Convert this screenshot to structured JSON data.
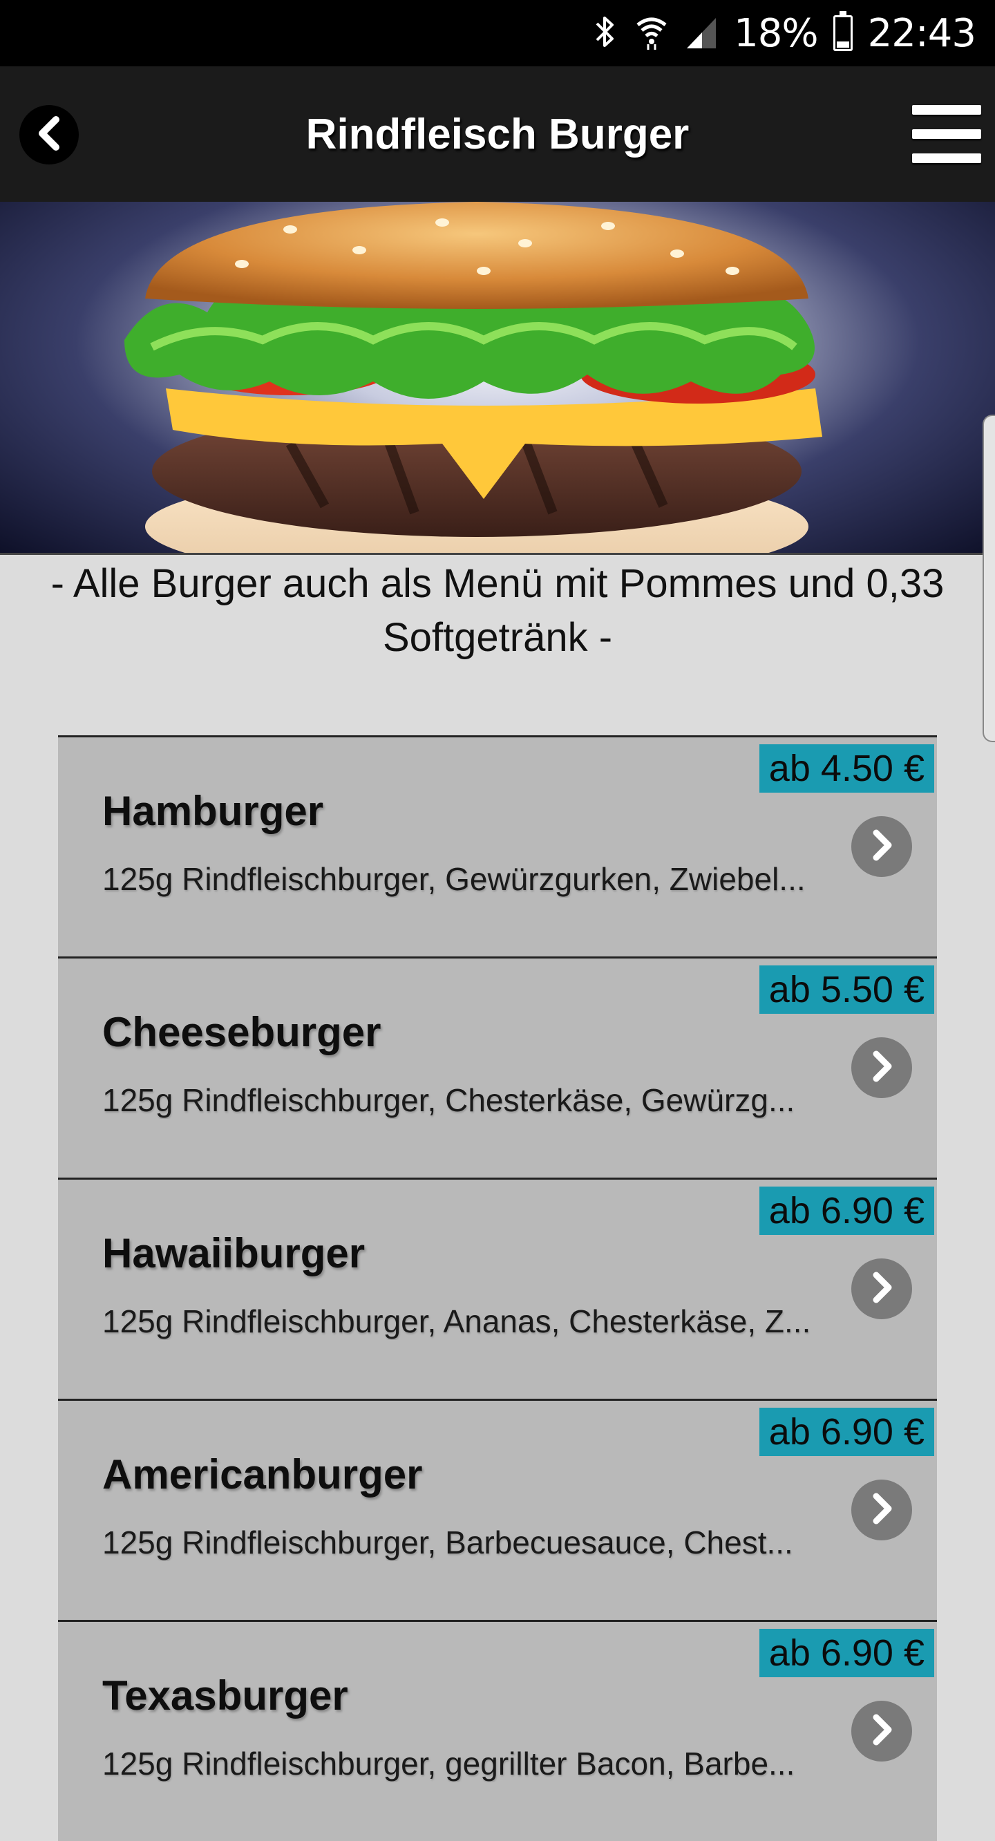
{
  "status_bar": {
    "battery": "18%",
    "time": "22:43",
    "icons": [
      "bluetooth-icon",
      "wifi-icon",
      "signal-icon",
      "battery-icon"
    ]
  },
  "header": {
    "title": "Rindfleisch Burger",
    "back_icon": "chevron-left-icon",
    "menu_icon": "hamburger-menu-icon"
  },
  "notice": {
    "line1": "- Alle Burger auch als Menü mit Pommes und 0,33",
    "line2": "Softgetränk -"
  },
  "colors": {
    "price_badge": "#1a9bb1",
    "item_background": "#b9b9b9",
    "header_background": "#1b1b1b"
  },
  "items": [
    {
      "name": "Hamburger",
      "price": "ab 4.50 €",
      "description": "125g Rindfleischburger, Gewürzgurken, Zwiebel..."
    },
    {
      "name": "Cheeseburger",
      "price": "ab 5.50 €",
      "description": "125g Rindfleischburger, Chesterkäse, Gewürzg..."
    },
    {
      "name": "Hawaiiburger",
      "price": "ab 6.90 €",
      "description": "125g Rindfleischburger, Ananas, Chesterkäse, Z..."
    },
    {
      "name": "Americanburger",
      "price": "ab 6.90 €",
      "description": "125g Rindfleischburger, Barbecuesauce, Chest..."
    },
    {
      "name": "Texasburger",
      "price": "ab 6.90 €",
      "description": "125g Rindfleischburger, gegrillter Bacon, Barbe..."
    }
  ]
}
